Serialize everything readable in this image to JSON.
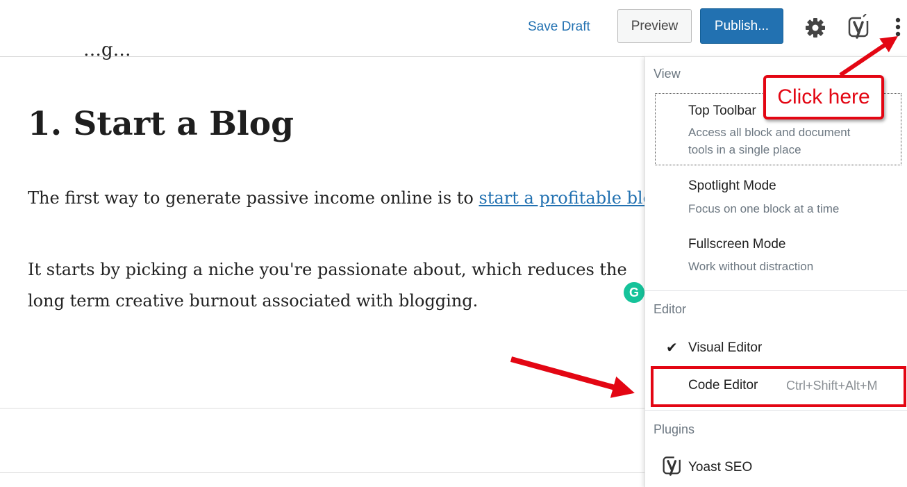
{
  "toolbar": {
    "save_draft": "Save Draft",
    "preview": "Preview",
    "publish": "Publish...",
    "settings_icon": "gear-icon",
    "yoast_icon": "yoast-icon",
    "more_icon": "vertical-ellipsis-icon"
  },
  "post": {
    "partial_text": "…g…",
    "heading": "1. Start a Blog",
    "p1_before": "The first way to generate passive income online is to ",
    "p1_link": "start a profitable blog",
    "p2": "It starts by picking a niche you're passionate about, which reduces the long term creative burnout associated with blogging.",
    "grammarly_badge": "G"
  },
  "menu": {
    "view_label": "View",
    "items": [
      {
        "title": "Top Toolbar",
        "desc": "Access all block and document tools in a single place"
      },
      {
        "title": "Spotlight Mode",
        "desc": "Focus on one block at a time"
      },
      {
        "title": "Fullscreen Mode",
        "desc": "Work without distraction"
      }
    ],
    "editor_label": "Editor",
    "visual_editor": "Visual Editor",
    "code_editor": "Code Editor",
    "code_editor_shortcut": "Ctrl+Shift+Alt+M",
    "plugins_label": "Plugins",
    "yoast_seo": "Yoast SEO"
  },
  "annotation": {
    "callout": "Click here",
    "accent_color": "#e30613"
  }
}
